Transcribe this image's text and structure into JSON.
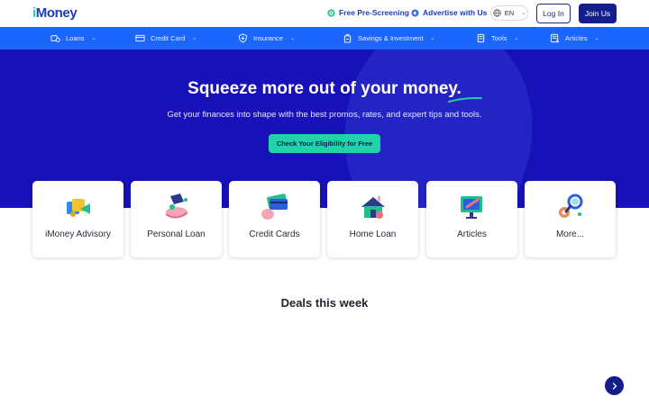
{
  "header": {
    "logo_text": "Money",
    "logo_prefix": "i",
    "links": [
      {
        "label": "Free Pre-Screening",
        "icon": "target-icon"
      },
      {
        "label": "Advertise with Us",
        "icon": "megaphone-icon"
      }
    ],
    "language": "EN",
    "login_label": "Log In",
    "join_label": "Join Us"
  },
  "nav": {
    "items": [
      {
        "label": "Loans",
        "icon": "loans-icon"
      },
      {
        "label": "Credit Card",
        "icon": "credit-card-icon"
      },
      {
        "label": "Insurance",
        "icon": "insurance-icon"
      },
      {
        "label": "Savings & Investment",
        "icon": "savings-icon"
      },
      {
        "label": "Tools",
        "icon": "tools-icon"
      },
      {
        "label": "Articles",
        "icon": "articles-icon"
      }
    ]
  },
  "hero": {
    "title": "Squeeze more out of your money.",
    "subtitle": "Get your finances into shape with the best promos, rates, and expert tips and tools.",
    "cta_label": "Check Your Eligibility for Free"
  },
  "categories": [
    {
      "label": "iMoney Advisory",
      "icon": "advisory-icon"
    },
    {
      "label": "Personal Loan",
      "icon": "personal-loan-icon"
    },
    {
      "label": "Credit Cards",
      "icon": "credit-cards-icon"
    },
    {
      "label": "Home Loan",
      "icon": "home-loan-icon"
    },
    {
      "label": "Articles",
      "icon": "articles-monitor-icon"
    },
    {
      "label": "More...",
      "icon": "more-gear-icon"
    }
  ],
  "deals": {
    "title": "Deals this week"
  },
  "colors": {
    "brand_blue": "#1d3bb8",
    "nav_blue": "#1a66ff",
    "hero_bg": "#1711b7",
    "accent_green": "#1fd4a6",
    "dark_button": "#141d8c"
  }
}
